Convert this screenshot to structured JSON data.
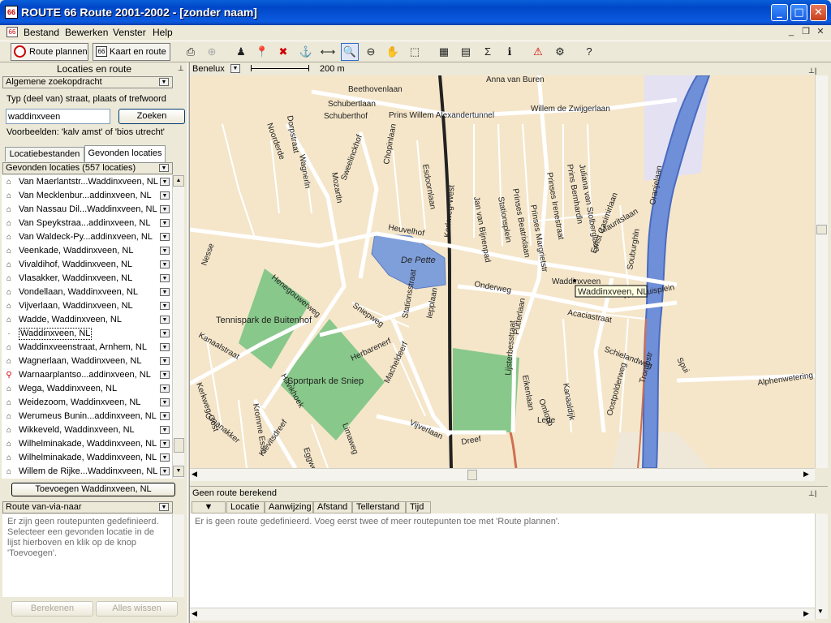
{
  "window": {
    "title": "ROUTE 66 Route 2001-2002 - [zonder naam]",
    "app_icon": "route66-app-icon"
  },
  "menu": [
    "Bestand",
    "Bewerken",
    "Venster",
    "Help"
  ],
  "toolbar": {
    "route_plannen": "Route plannen",
    "kaart_en_route": "Kaart en route"
  },
  "left_panel": {
    "title": "Locaties en route",
    "search_section": "Algemene zoekopdracht",
    "search_hint": "Typ (deel van) straat, plaats of trefwoord",
    "search_value": "waddinxveen",
    "search_button": "Zoeken",
    "examples": "Voorbeelden: 'kalv amst' of 'bios utrecht'",
    "tabs": [
      "Locatiebestanden",
      "Gevonden locaties"
    ],
    "found_header": "Gevonden locaties (557 locaties)",
    "results": [
      {
        "text": "Van Maerlantstr...Waddinxveen, NL",
        "icon": "house-icon"
      },
      {
        "text": "Van Mecklenbur...addinxveen, NL",
        "icon": "house-icon"
      },
      {
        "text": "Van Nassau Dil...Waddinxveen, NL",
        "icon": "house-icon"
      },
      {
        "text": "Van Speykstraa...addinxveen, NL",
        "icon": "house-icon"
      },
      {
        "text": "Van Waldeck-Py...addinxveen, NL",
        "icon": "house-icon"
      },
      {
        "text": "Veenkade, Waddinxveen, NL",
        "icon": "house-icon"
      },
      {
        "text": "Vivaldihof, Waddinxveen, NL",
        "icon": "house-icon"
      },
      {
        "text": "Vlasakker, Waddinxveen, NL",
        "icon": "house-icon"
      },
      {
        "text": "Vondellaan, Waddinxveen, NL",
        "icon": "house-icon"
      },
      {
        "text": "Vijverlaan, Waddinxveen, NL",
        "icon": "house-icon"
      },
      {
        "text": "Wadde, Waddinxveen, NL",
        "icon": "house-icon"
      },
      {
        "text": "Waddinxveen, NL",
        "icon": "dot-icon",
        "selected": true
      },
      {
        "text": "Waddinxveenstraat, Arnhem, NL",
        "icon": "house-icon"
      },
      {
        "text": "Wagnerlaan, Waddinxveen, NL",
        "icon": "house-icon"
      },
      {
        "text": "Warnaarplantso...addinxveen, NL",
        "icon": "pin-icon"
      },
      {
        "text": "Wega, Waddinxveen, NL",
        "icon": "house-icon"
      },
      {
        "text": "Weidezoom, Waddinxveen, NL",
        "icon": "house-icon"
      },
      {
        "text": "Werumeus Bunin...addinxveen, NL",
        "icon": "house-icon"
      },
      {
        "text": "Wikkeveld, Waddinxveen, NL",
        "icon": "house-icon"
      },
      {
        "text": "Wilhelminakade, Waddinxveen, NL",
        "icon": "house-icon"
      },
      {
        "text": "Wilhelminakade, Waddinxveen, NL",
        "icon": "house-icon"
      },
      {
        "text": "Willem de Rijke...Waddinxveen, NL",
        "icon": "house-icon"
      }
    ],
    "add_button": "Toevoegen Waddinxveen, NL",
    "route_section": "Route van-via-naar",
    "route_hint": "Er zijn geen routepunten gedefinieerd. Selecteer een gevonden locatie in de lijst hierboven en klik op de knop 'Toevoegen'.",
    "calc_button": "Berekenen",
    "clear_button": "Alles wissen"
  },
  "map": {
    "region": "Benelux",
    "scale_label": "200 m",
    "marker_label": "Waddinxveen, NL",
    "town_label": "Waddinxveen",
    "places": [
      "De Pette",
      "Tennispark de Buitenhof",
      "Sportpark de Sniep"
    ],
    "streets": [
      "Beethovenlaan",
      "Prins Willem Alexandertunnel",
      "Willem de Zwijgerlaan",
      "Anna van Buren",
      "Schubertlaan",
      "Schuberthof",
      "Noorderde",
      "Dorpstraat",
      "Wagnerln",
      "Mozartln",
      "Sweelinckhof",
      "Chopinlaan",
      "Heuvelhof",
      "Esdoornlaan",
      "Kerkweg-West",
      "Jan van Bijnenpad",
      "Stationsplein",
      "Prinses Beatrixlaan",
      "Prinses Margrietstr",
      "Prinses Irenestraat",
      "Prins Bernhardln",
      "Juliana van Stolberglaan",
      "Ernst Casimirlaan",
      "Mauritslaan",
      "Souburghln",
      "Oranjelaan",
      "Nesse",
      "Henegouwerweg",
      "Onderweg",
      "Sniepweg",
      "Stationsstraat",
      "Iepplaan",
      "Acaciastraat",
      "Putterlaan",
      "Raadhuisplein",
      "Kanaalstraat",
      "Kerkweg-Oost",
      "Herbarenerf",
      "Macheldeerf",
      "Lijsterbesstraat",
      "Eikenlaan",
      "Kanaaldijk",
      "Schielandweg",
      "Oostpolderweg",
      "Spui",
      "Alphenwetering",
      "Kromme Esse",
      "Havikhoek",
      "Dreef",
      "Vijverlaan",
      "Omloop",
      "Lede",
      "Trompstr",
      "Kievitsdreef",
      "Graanakker",
      "Limaweg",
      "Eggweg"
    ]
  },
  "route_panel": {
    "title": "Geen route berekend",
    "columns": [
      "Locatie",
      "Aanwijzing",
      "Afstand",
      "Tellerstand",
      "Tijd"
    ],
    "message": "Er is geen route gedefinieerd. Voeg eerst twee of meer routepunten toe met 'Route plannen'."
  }
}
